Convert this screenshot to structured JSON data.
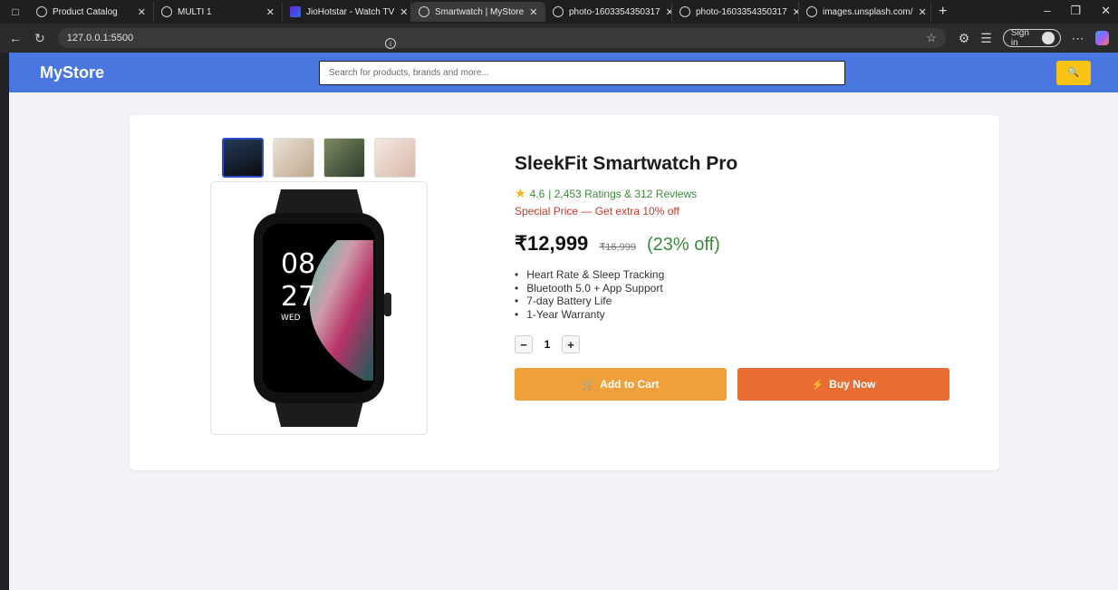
{
  "browser": {
    "tabs": [
      {
        "title": "Product Catalog",
        "active": false
      },
      {
        "title": "MULTI 1",
        "active": false
      },
      {
        "title": "JioHotstar - Watch TV",
        "active": false
      },
      {
        "title": "Smartwatch | MyStore",
        "active": true
      },
      {
        "title": "photo-1603354350317",
        "active": false
      },
      {
        "title": "photo-1603354350317",
        "active": false
      },
      {
        "title": "images.unsplash.com/",
        "active": false
      }
    ],
    "url": "127.0.0.1:5500",
    "sign_in_label": "Sign in"
  },
  "store": {
    "logo": "MyStore",
    "search_placeholder": "Search for products, brands and more..."
  },
  "product": {
    "title": "SleekFit Smartwatch Pro",
    "rating": "4.6",
    "rating_text": "| 2,453 Ratings & 312 Reviews",
    "special": "Special Price — Get extra 10% off",
    "price": "₹12,999",
    "mrp": "₹16,999",
    "discount": "(23% off)",
    "features": [
      "Heart Rate & Sleep Tracking",
      "Bluetooth 5.0 + App Support",
      "7-day Battery Life",
      "1-Year Warranty"
    ],
    "quantity": "1",
    "watch_face": {
      "hour": "08",
      "minute": "27",
      "day": "WED"
    },
    "add_to_cart_label": "Add to Cart",
    "buy_now_label": "Buy Now"
  },
  "colors": {
    "header": "#4a76e0",
    "search_button": "#f9c315",
    "add_to_cart": "#f0a03b",
    "buy_now": "#e96d32",
    "discount_green": "#3b8a3b",
    "special_red": "#c0392b"
  }
}
